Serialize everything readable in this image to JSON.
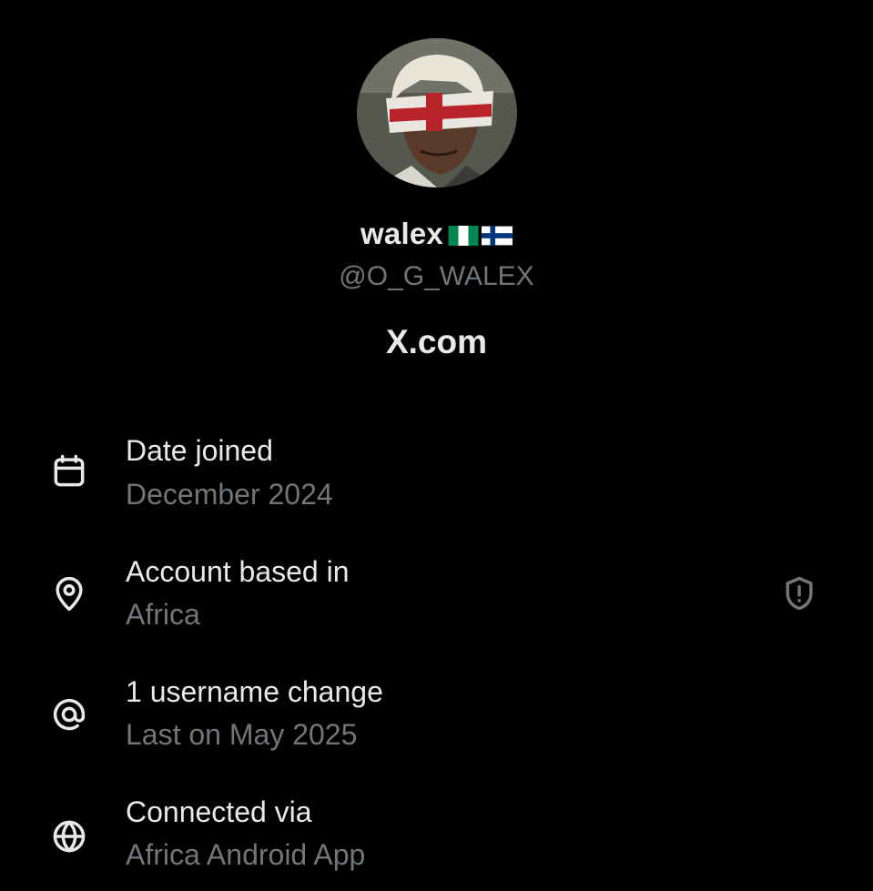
{
  "profile": {
    "display_name": "walex",
    "flags": [
      "Nigeria flag",
      "Finland flag"
    ],
    "handle": "@O_G_WALEX",
    "site": "X.com"
  },
  "info": [
    {
      "icon": "calendar-icon",
      "title": "Date joined",
      "value": "December 2024"
    },
    {
      "icon": "location-pin-icon",
      "title": "Account based in",
      "value": "Africa",
      "trailing_icon": "shield-alert-icon"
    },
    {
      "icon": "at-sign-icon",
      "title": "1 username change",
      "value": "Last on May 2025"
    },
    {
      "icon": "globe-icon",
      "title": "Connected via",
      "value": "Africa Android App"
    }
  ],
  "colors": {
    "background": "#000000",
    "primary_text": "#e7e9ea",
    "secondary_text": "#71767b",
    "nigeria_green": "#008751",
    "finland_blue": "#003580"
  }
}
